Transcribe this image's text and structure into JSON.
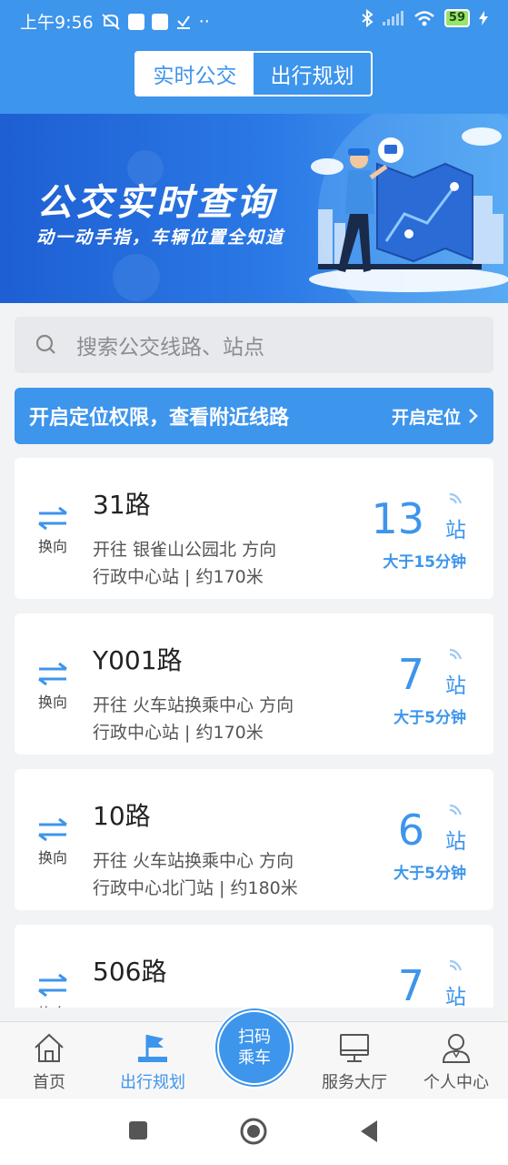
{
  "status_bar": {
    "time": "上午9:56",
    "extra": "··",
    "battery": "59"
  },
  "header": {
    "tabs": [
      {
        "label": "实时公交"
      },
      {
        "label": "出行规划"
      }
    ]
  },
  "banner": {
    "title": "公交实时查询",
    "subtitle": "动一动手指，车辆位置全知道"
  },
  "search": {
    "placeholder": "搜索公交线路、站点"
  },
  "location": {
    "message": "开启定位权限，查看附近线路",
    "button": "开启定位"
  },
  "routes": [
    {
      "swap_label": "换向",
      "name": "31路",
      "direction": "开往 银雀山公园北 方向",
      "stop": "行政中心站 | 约170米",
      "stops_away": "13",
      "unit": "站",
      "time": "大于15分钟"
    },
    {
      "swap_label": "换向",
      "name": "Y001路",
      "direction": "开往 火车站换乘中心 方向",
      "stop": "行政中心站 | 约170米",
      "stops_away": "7",
      "unit": "站",
      "time": "大于5分钟"
    },
    {
      "swap_label": "换向",
      "name": "10路",
      "direction": "开往 火车站换乘中心 方向",
      "stop": "行政中心北门站 | 约180米",
      "stops_away": "6",
      "unit": "站",
      "time": "大于5分钟"
    },
    {
      "swap_label": "换向",
      "name": "506路",
      "direction": "",
      "stop": "",
      "stops_away": "7",
      "unit": "站",
      "time": ""
    }
  ],
  "bottom_nav": {
    "home": "首页",
    "plan": "出行规划",
    "scan_line1": "扫码",
    "scan_line2": "乘车",
    "service": "服务大厅",
    "profile": "个人中心"
  },
  "colors": {
    "primary": "#3d95ec",
    "background": "#f2f3f5"
  }
}
